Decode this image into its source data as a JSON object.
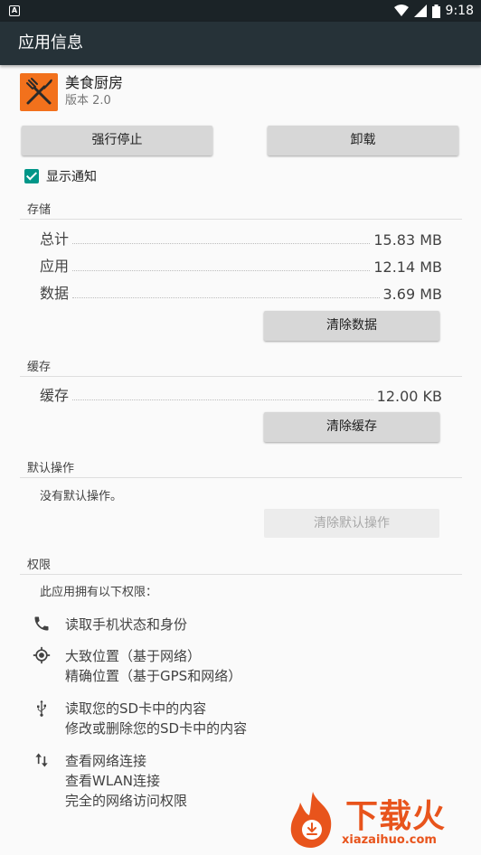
{
  "status_bar": {
    "time": "9:18",
    "icons": [
      "notification-a-icon",
      "wifi-icon",
      "signal-icon",
      "battery-icon"
    ]
  },
  "app_bar": {
    "title": "应用信息"
  },
  "app": {
    "name": "美食厨房",
    "version": "版本 2.0"
  },
  "buttons": {
    "force_stop": "强行停止",
    "uninstall": "卸载",
    "clear_data": "清除数据",
    "clear_cache": "清除缓存",
    "clear_defaults": "清除默认操作"
  },
  "show_notifications": {
    "label": "显示通知",
    "checked": true
  },
  "storage": {
    "title": "存储",
    "rows": [
      {
        "label": "总计",
        "value": "15.83 MB"
      },
      {
        "label": "应用",
        "value": "12.14 MB"
      },
      {
        "label": "数据",
        "value": "3.69 MB"
      }
    ]
  },
  "cache": {
    "title": "缓存",
    "rows": [
      {
        "label": "缓存",
        "value": "12.00 KB"
      }
    ]
  },
  "defaults": {
    "title": "默认操作",
    "text": "没有默认操作。"
  },
  "permissions": {
    "title": "权限",
    "intro": "此应用拥有以下权限：",
    "groups": [
      {
        "icon": "phone-icon",
        "lines": [
          "读取手机状态和身份"
        ]
      },
      {
        "icon": "location-icon",
        "lines": [
          "大致位置（基于网络）",
          "精确位置（基于GPS和网络）"
        ]
      },
      {
        "icon": "usb-icon",
        "lines": [
          "读取您的SD卡中的内容",
          "修改或删除您的SD卡中的内容"
        ]
      },
      {
        "icon": "network-arrows-icon",
        "lines": [
          "查看网络连接",
          "查看WLAN连接",
          "完全的网络访问权限"
        ]
      }
    ]
  },
  "watermark": {
    "text": "下载火",
    "url": "xiazaihuo.com"
  },
  "colors": {
    "app_bar": "#263238",
    "status_bar": "#1b2327",
    "accent": "#009688",
    "logo": "#f2711c",
    "watermark": "#e8541c"
  }
}
